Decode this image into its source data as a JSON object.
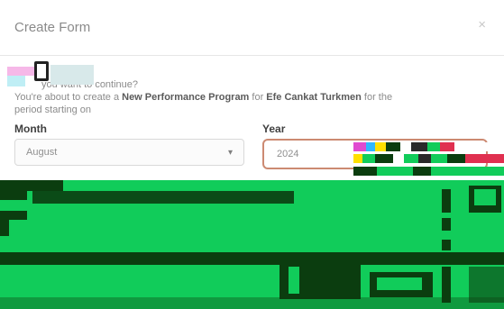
{
  "modal": {
    "title": "Create Form",
    "close_glyph": "×",
    "question_line1": "you want to continue?",
    "question_line2_prefix": "You're about to create a ",
    "program_name": "New Performance Program",
    "question_line2_mid": " for ",
    "employee_name": "Efe Cankat Turkmen",
    "question_line2_suffix": " for the",
    "question_line3": "period starting on",
    "month": {
      "label": "Month",
      "value": "August"
    },
    "year": {
      "label": "Year",
      "value": "2024"
    }
  },
  "colors": {
    "year_border": "#cc8a72",
    "panel_green": "#11cc5a",
    "panel_dark": "#0b3d0f"
  },
  "icons": [
    "close-icon",
    "chevron-down-icon"
  ]
}
